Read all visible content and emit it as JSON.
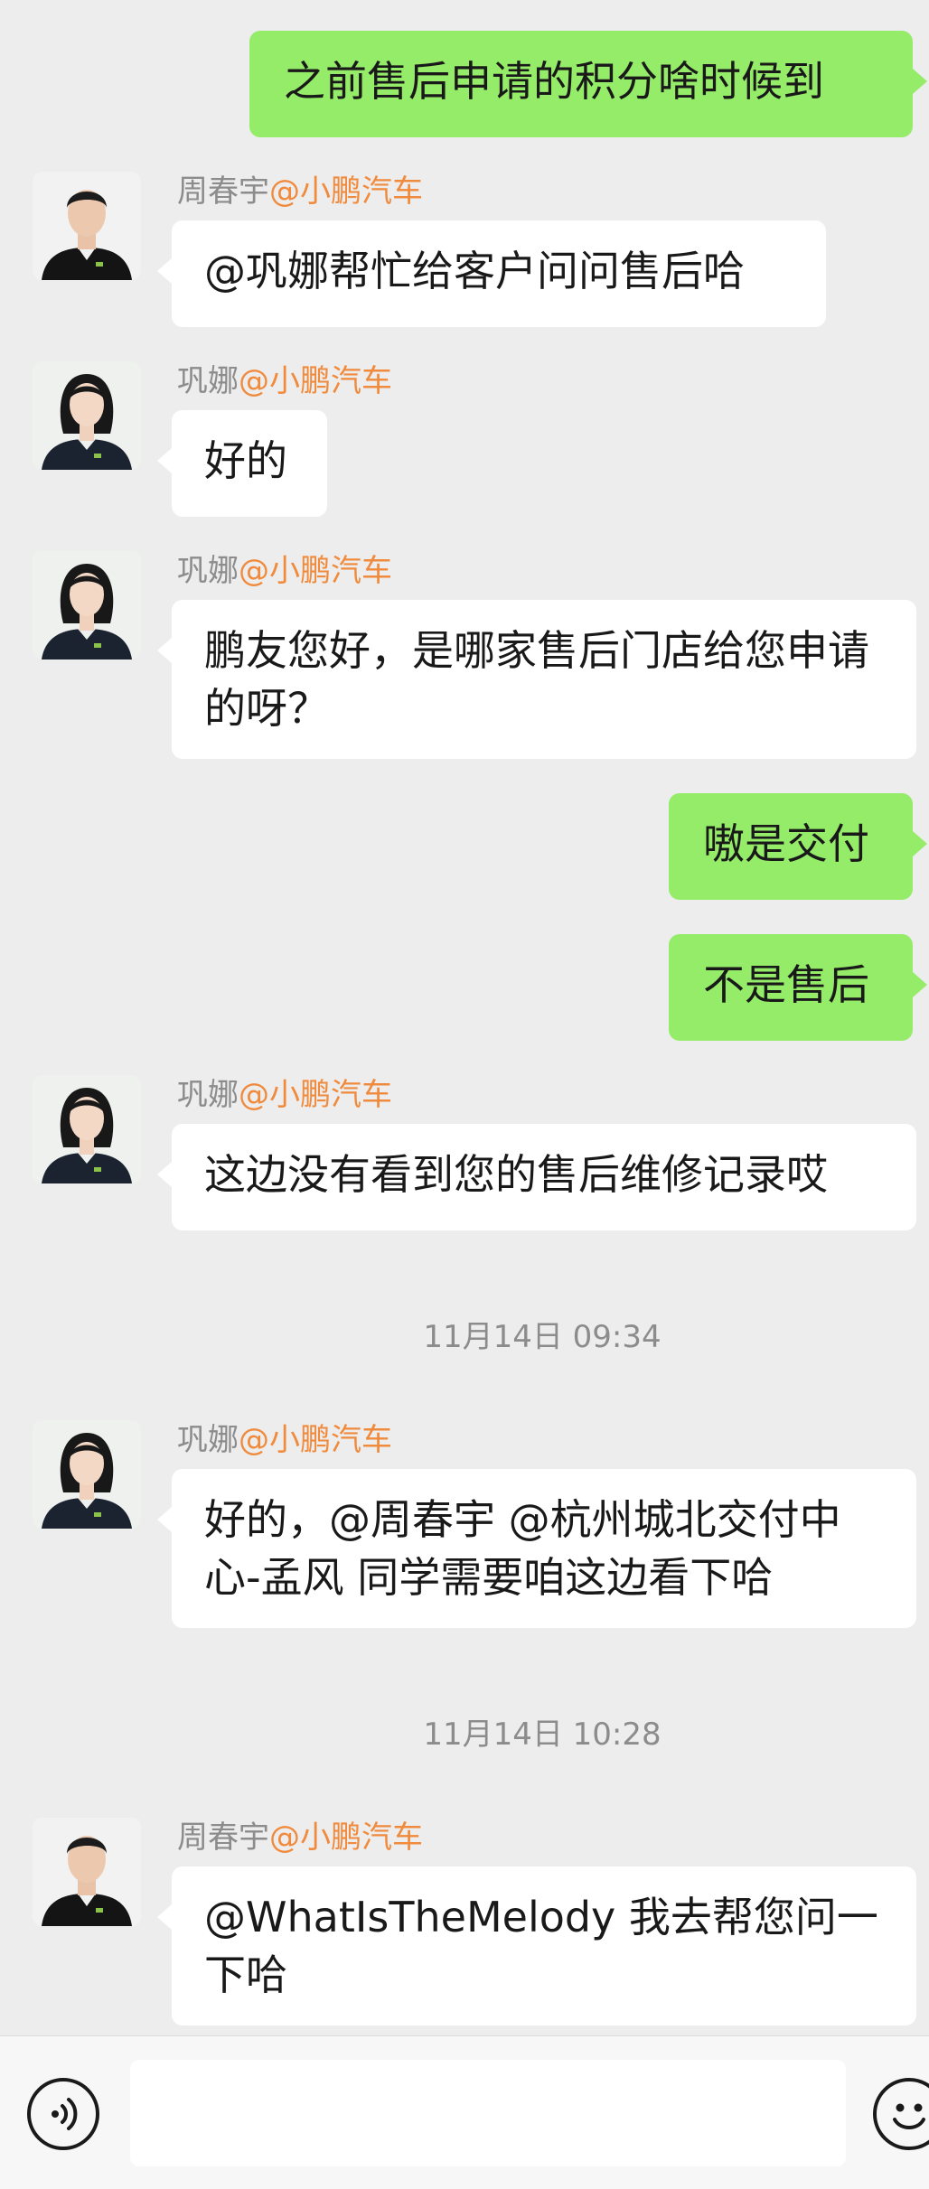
{
  "colors": {
    "background": "#ededed",
    "outgoing_bubble": "#95ec69",
    "incoming_bubble": "#ffffff",
    "org_tag": "#f08a3c",
    "sender_name": "#8c8c8c"
  },
  "messages": [
    {
      "direction": "out",
      "text": "之前售后申请的积分啥时候到"
    },
    {
      "direction": "in",
      "sender": "周春宇",
      "org": "@小鹏汽车",
      "avatar": "male-avatar",
      "text": "@巩娜帮忙给客户问问售后哈"
    },
    {
      "direction": "in",
      "sender": "巩娜",
      "org": "@小鹏汽车",
      "avatar": "female-avatar",
      "text": "好的"
    },
    {
      "direction": "in",
      "sender": "巩娜",
      "org": "@小鹏汽车",
      "avatar": "female-avatar",
      "text": "鹏友您好，是哪家售后门店给您申请的呀？"
    },
    {
      "direction": "out",
      "text": "嗷是交付"
    },
    {
      "direction": "out",
      "text": "不是售后"
    },
    {
      "direction": "in",
      "sender": "巩娜",
      "org": "@小鹏汽车",
      "avatar": "female-avatar",
      "text": "这边没有看到您的售后维修记录哎"
    },
    {
      "direction": "in",
      "sender": "巩娜",
      "org": "@小鹏汽车",
      "avatar": "female-avatar",
      "text": "好的，@周春宇 @杭州城北交付中心-孟风 同学需要咱这边看下哈"
    },
    {
      "direction": "in",
      "sender": "周春宇",
      "org": "@小鹏汽车",
      "avatar": "male-avatar",
      "text": "@WhatIsTheMelody 我去帮您问一下哈"
    }
  ],
  "timestamps": [
    "11月14日 09:34",
    "11月14日 10:28"
  ],
  "composer": {
    "voice_icon": "voice-icon",
    "emoji_icon": "emoji-icon",
    "input_value": ""
  }
}
